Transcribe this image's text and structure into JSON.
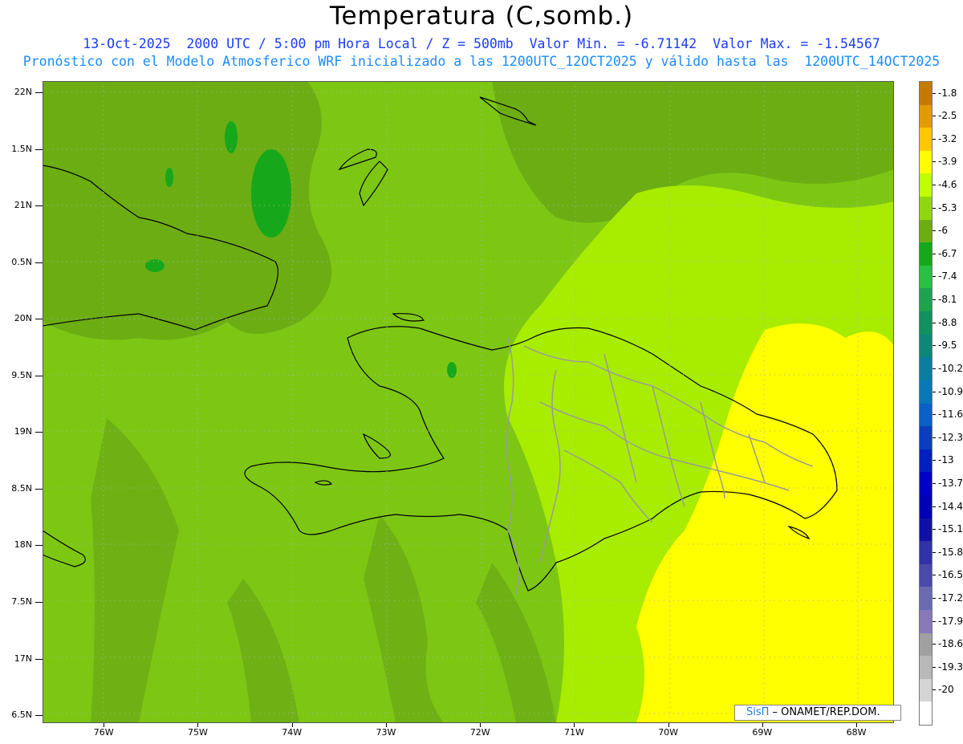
{
  "header": {
    "title": "Temperatura (C,somb.)",
    "line1": "13-Oct-2025  2000 UTC / 5:00 pm Hora Local / Z = 500mb  Valor Min. = -6.71142  Valor Max. = -1.54567",
    "line2": "Pronóstico con el Modelo Atmosferico WRF inicializado a las 1200UTC_12OCT2025 y válido hasta las  1200UTC_14OCT2025"
  },
  "map": {
    "lat_labels": [
      "22N",
      "1.5N",
      "21N",
      "0.5N",
      "20N",
      "9.5N",
      "19N",
      "8.5N",
      "18N",
      "7.5N",
      "17N",
      "6.5N"
    ],
    "lon_labels": [
      "76W",
      "75W",
      "74W",
      "73W",
      "72W",
      "71W",
      "70W",
      "69W",
      "68W"
    ],
    "lon_range": [
      -76.65,
      -67.6
    ],
    "lat_range": [
      16.43,
      22.1
    ],
    "lat_values": [
      22,
      21.5,
      21,
      20.5,
      20,
      19.5,
      19,
      18.5,
      18,
      17.5,
      17,
      16.5
    ],
    "lon_values": [
      -76,
      -75,
      -74,
      -73,
      -72,
      -71,
      -70,
      -69,
      -68
    ]
  },
  "colorbar": {
    "labels": [
      "-1.8",
      "-2.5",
      "-3.2",
      "-3.9",
      "-4.6",
      "-5.3",
      "-6",
      "-6.7",
      "-7.4",
      "-8.1",
      "-8.8",
      "-9.5",
      "-10.2",
      "-10.9",
      "-11.6",
      "-12.3",
      "-13",
      "-13.7",
      "-14.4",
      "-15.1",
      "-15.8",
      "-16.5",
      "-17.2",
      "-17.9",
      "-18.6",
      "-19.3",
      "-20"
    ],
    "colors": [
      "#c47c00",
      "#e09c00",
      "#ffc800",
      "#ffff00",
      "#bfff00",
      "#90d80e",
      "#6cad14",
      "#16a81a",
      "#2bbf43",
      "#1ea24e",
      "#119062",
      "#0c8878",
      "#0a7ea0",
      "#0a78b8",
      "#0b5fc7",
      "#0a3dc0",
      "#0020c0",
      "#0000c8",
      "#0000b8",
      "#1010a8",
      "#3232a8",
      "#4a4aa8",
      "#6a6ab0",
      "#8878b8",
      "#a0a0a0",
      "#b8b8b8",
      "#d4d4d4",
      "#ffffff"
    ]
  },
  "logo": {
    "brand": "SisΠ",
    "org": " – ONAMET/REP.DOM."
  }
}
